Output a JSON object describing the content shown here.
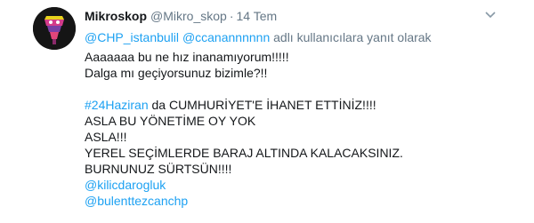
{
  "tweet": {
    "name": "Mikroskop",
    "handle": "@Mikro_skop",
    "separator": "·",
    "time": "14 Tem",
    "caret_icon": "chevron-down-icon",
    "reply_mention_1": "@CHP_istanbulil",
    "reply_mention_2": "@ccanannnnnn",
    "reply_suffix": "adlı kullanıcılara yanıt olarak",
    "lines": {
      "l1": "Aaaaaaa  bu ne hız inanamıyorum!!!!!",
      "l2": "Dalga mı geçiyorsunuz bizimle?!!",
      "hashtag": "#24Haziran",
      "l4_rest": " da CUMHURİYET'E İHANET ETTİNİZ!!!!",
      "l5": "ASLA BU YÖNETİME OY YOK",
      "l6": "ASLA!!!",
      "l7": "YEREL SEÇİMLERDE BARAJ ALTINDA KALACAKSINIZ.",
      "l8": "BURNUNUZ SÜRTSÜN!!!!",
      "mention_a": "@kilicdarogluk",
      "mention_b": "@bulenttezcanchp"
    },
    "colors": {
      "link": "#1da1f2",
      "muted": "#657786",
      "text": "#14171a"
    }
  }
}
